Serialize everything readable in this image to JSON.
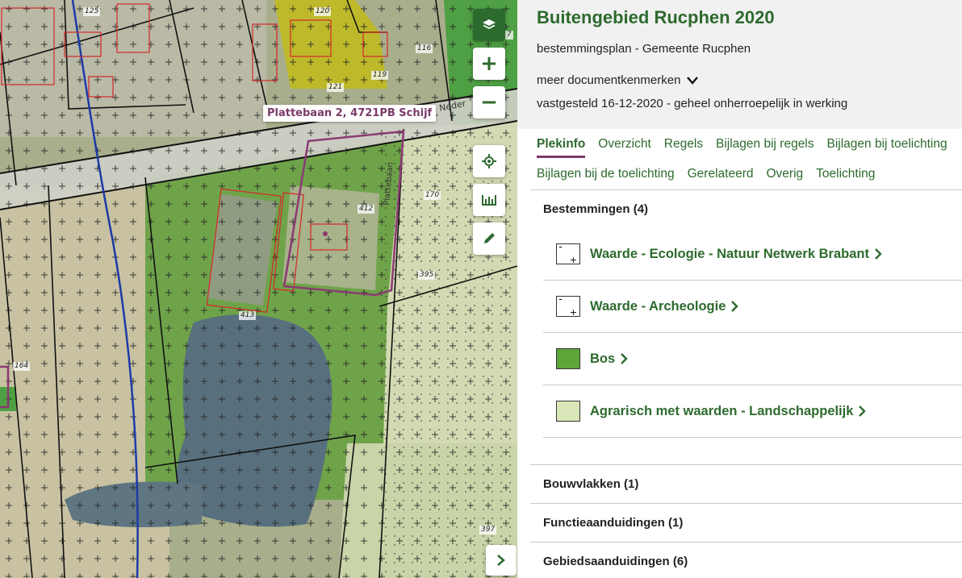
{
  "map": {
    "address_tooltip": "Plattebaan 2, 4721PB Schijf",
    "parcel_labels": [
      "125",
      "120",
      "116",
      "121",
      "119",
      "412",
      "170",
      "395",
      "413",
      "164",
      "397",
      "7"
    ],
    "road_labels": [
      "Neder",
      "Plattebaan"
    ],
    "controls": {
      "layers_icon": "layers-icon",
      "zoom_in": "+",
      "zoom_out": "−",
      "locate_icon": "locate-icon",
      "measure_icon": "measure-icon",
      "draw_icon": "pencil-icon",
      "expand_icon": "chevron-right-icon"
    },
    "colors": {
      "plan_outline": "#8b3a73",
      "bouwvlak": "#d62728",
      "bos": "#5fa53a",
      "agrarisch": "#d9e6b7",
      "water": "#1e3aa8"
    }
  },
  "document": {
    "title": "Buitengebied Rucphen 2020",
    "subtitle": "bestemmingsplan - Gemeente Rucphen",
    "more": "meer documentkenmerken",
    "status": "vastgesteld 16-12-2020 - geheel onherroepelijk in werking"
  },
  "tabs": {
    "row1": [
      "Plekinfo",
      "Overzicht",
      "Regels",
      "Bijlagen bij regels",
      "Bijlagen bij toelichting"
    ],
    "row2": [
      "Bijlagen bij de toelichting",
      "Gerelateerd",
      "Overig",
      "Toelichting"
    ],
    "active": "Plekinfo"
  },
  "bestemmingen": {
    "title": "Bestemmingen (4)",
    "items": [
      {
        "label": "Waarde - Ecologie - Natuur Netwerk Brabant",
        "swatch": "#ffffff",
        "pattern": "cross"
      },
      {
        "label": "Waarde - Archeologie",
        "swatch": "#ffffff",
        "pattern": "cross"
      },
      {
        "label": "Bos",
        "swatch": "#5fa53a",
        "pattern": "none"
      },
      {
        "label": "Agrarisch met waarden - Landschappelijk",
        "swatch": "#d9e6b7",
        "pattern": "none"
      }
    ]
  },
  "sections": {
    "bouwvlakken": "Bouwvlakken (1)",
    "functieaanduidingen": "Functieaanduidingen (1)",
    "gebiedsaanduidingen": "Gebiedsaanduidingen (6)"
  }
}
